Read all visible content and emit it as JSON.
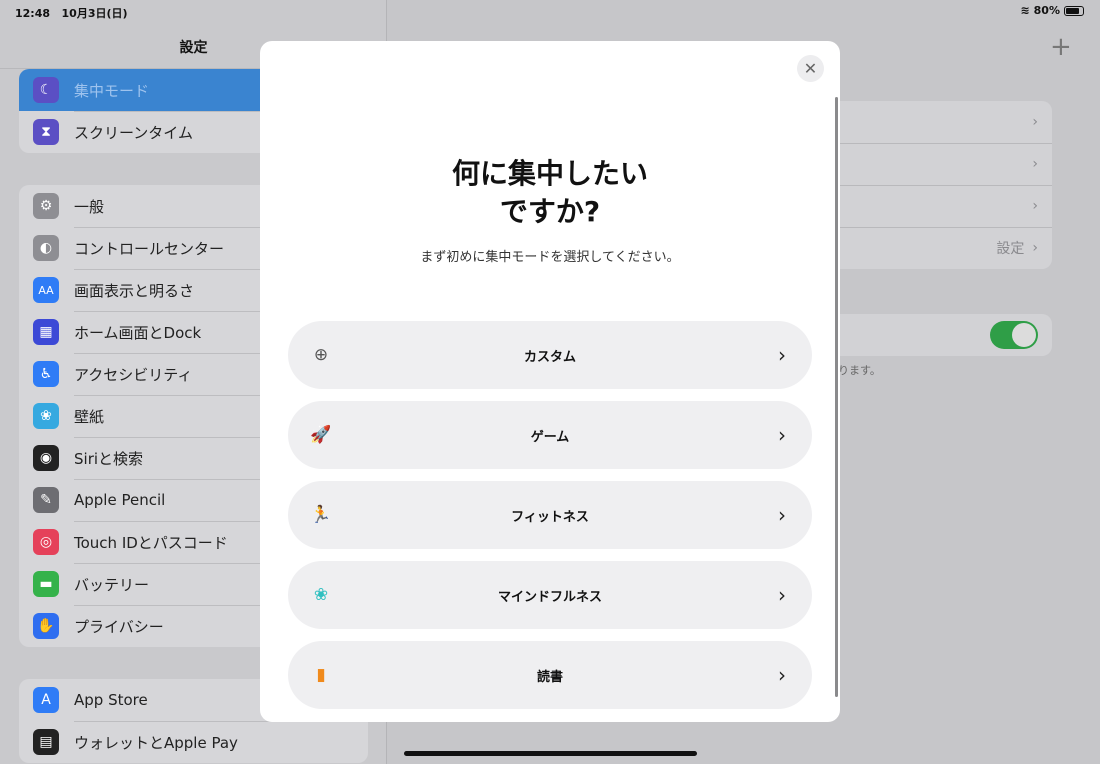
{
  "status": {
    "time": "12:48",
    "date": "10月3日(日)",
    "battery": "80%",
    "battery_level": 0.8
  },
  "sidebar": {
    "title": "設定",
    "group1": [
      {
        "label": "集中モード",
        "icon": "moon-icon",
        "color": "#5b4fc4",
        "selected": true
      },
      {
        "label": "スクリーンタイム",
        "icon": "hourglass-icon",
        "color": "#5b4fc4"
      }
    ],
    "group2": [
      {
        "label": "一般",
        "icon": "gear-icon",
        "color": "#8e8e93"
      },
      {
        "label": "コントロールセンター",
        "icon": "switches-icon",
        "color": "#8e8e93"
      },
      {
        "label": "画面表示と明るさ",
        "icon": "text-size-icon",
        "color": "#2f7cf6"
      },
      {
        "label": "ホーム画面とDock",
        "icon": "grid-icon",
        "color": "#3c49d6"
      },
      {
        "label": "アクセシビリティ",
        "icon": "accessibility-icon",
        "color": "#2f7cf6"
      },
      {
        "label": "壁紙",
        "icon": "flower-icon",
        "color": "#36a9e0"
      },
      {
        "label": "Siriと検索",
        "icon": "siri-icon",
        "color": "#222"
      },
      {
        "label": "Apple Pencil",
        "icon": "pencil-icon",
        "color": "#6d6d72"
      },
      {
        "label": "Touch IDとパスコード",
        "icon": "fingerprint-icon",
        "color": "#e5415a"
      },
      {
        "label": "バッテリー",
        "icon": "battery-icon",
        "color": "#35b24a"
      },
      {
        "label": "プライバシー",
        "icon": "hand-icon",
        "color": "#2f6ef0"
      }
    ],
    "group3": [
      {
        "label": "App Store",
        "icon": "app-store-icon",
        "color": "#2f7cf6"
      },
      {
        "label": "ウォレットとApple Pay",
        "icon": "wallet-icon",
        "color": "#222"
      }
    ]
  },
  "detail": {
    "settings_value": "設定",
    "note": "ります。",
    "toggle_on": true
  },
  "modal": {
    "title_line1": "何に集中したい",
    "title_line2": "ですか?",
    "subtitle": "まず初めに集中モードを選択してください。",
    "options": [
      {
        "label": "カスタム",
        "icon": "plus-circle-icon",
        "color": "#555"
      },
      {
        "label": "ゲーム",
        "icon": "rocket-icon",
        "color": "#2f6ef0"
      },
      {
        "label": "フィットネス",
        "icon": "running-icon",
        "color": "#35c04a"
      },
      {
        "label": "マインドフルネス",
        "icon": "flower-icon",
        "color": "#30c0c0"
      },
      {
        "label": "読書",
        "icon": "book-icon",
        "color": "#f08a1c"
      }
    ]
  }
}
